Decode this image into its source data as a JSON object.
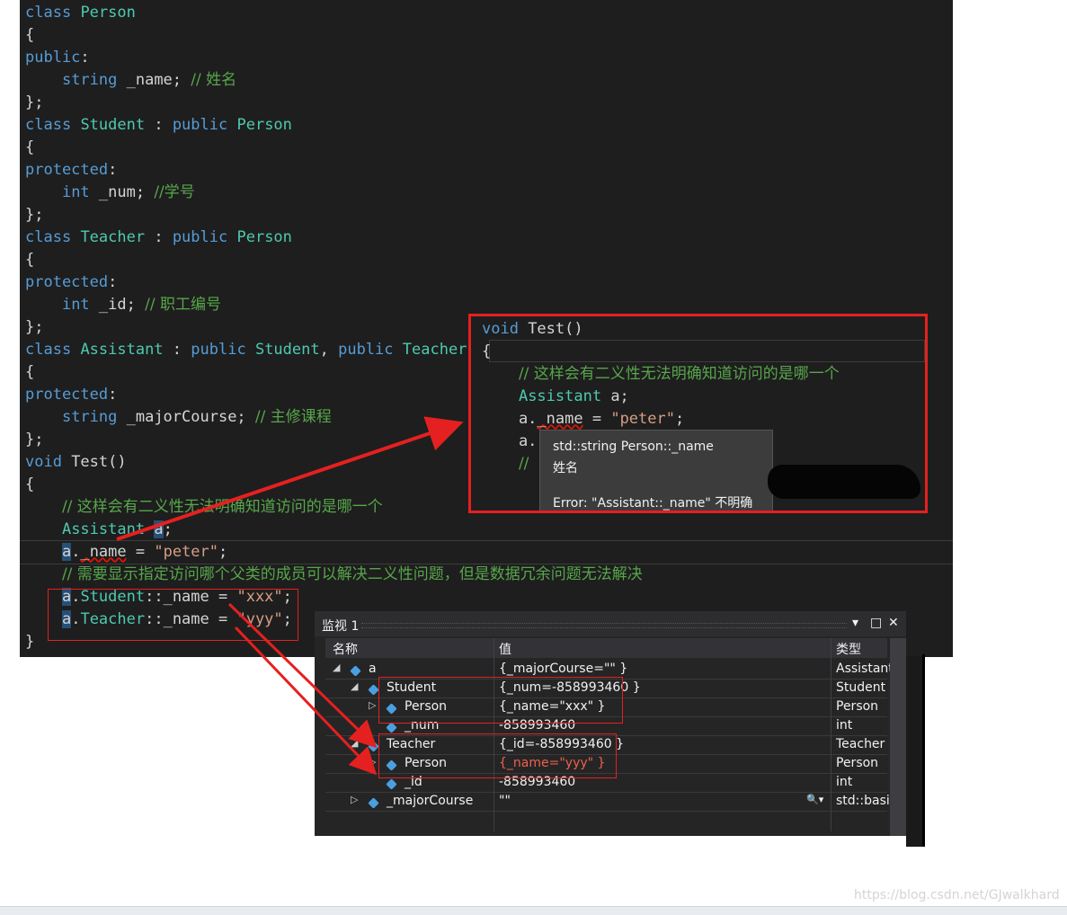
{
  "code_lines": [
    [
      {
        "c": "kw",
        "t": "class"
      },
      {
        "c": "pl",
        "t": " "
      },
      {
        "c": "ty",
        "t": "Person"
      }
    ],
    [
      {
        "c": "pl",
        "t": "{"
      }
    ],
    [
      {
        "c": "kw",
        "t": "public"
      },
      {
        "c": "pl",
        "t": ":"
      }
    ],
    [
      {
        "c": "pl",
        "t": "    "
      },
      {
        "c": "kw",
        "t": "string"
      },
      {
        "c": "pl",
        "t": " _name; "
      },
      {
        "c": "cm",
        "t": "// 姓名"
      }
    ],
    [
      {
        "c": "pl",
        "t": "};"
      }
    ],
    [
      {
        "c": "kw",
        "t": "class"
      },
      {
        "c": "pl",
        "t": " "
      },
      {
        "c": "ty",
        "t": "Student"
      },
      {
        "c": "pl",
        "t": " : "
      },
      {
        "c": "kw",
        "t": "public"
      },
      {
        "c": "pl",
        "t": " "
      },
      {
        "c": "ty",
        "t": "Person"
      }
    ],
    [
      {
        "c": "pl",
        "t": "{"
      }
    ],
    [
      {
        "c": "kw",
        "t": "protected"
      },
      {
        "c": "pl",
        "t": ":"
      }
    ],
    [
      {
        "c": "pl",
        "t": "    "
      },
      {
        "c": "kw",
        "t": "int"
      },
      {
        "c": "pl",
        "t": " _num; "
      },
      {
        "c": "cm",
        "t": "//学号"
      }
    ],
    [
      {
        "c": "pl",
        "t": "};"
      }
    ],
    [
      {
        "c": "kw",
        "t": "class"
      },
      {
        "c": "pl",
        "t": " "
      },
      {
        "c": "ty",
        "t": "Teacher"
      },
      {
        "c": "pl",
        "t": " : "
      },
      {
        "c": "kw",
        "t": "public"
      },
      {
        "c": "pl",
        "t": " "
      },
      {
        "c": "ty",
        "t": "Person"
      }
    ],
    [
      {
        "c": "pl",
        "t": "{"
      }
    ],
    [
      {
        "c": "kw",
        "t": "protected"
      },
      {
        "c": "pl",
        "t": ":"
      }
    ],
    [
      {
        "c": "pl",
        "t": "    "
      },
      {
        "c": "kw",
        "t": "int"
      },
      {
        "c": "pl",
        "t": " _id; "
      },
      {
        "c": "cm",
        "t": "// 职工编号"
      }
    ],
    [
      {
        "c": "pl",
        "t": "};"
      }
    ],
    [
      {
        "c": "kw",
        "t": "class"
      },
      {
        "c": "pl",
        "t": " "
      },
      {
        "c": "ty",
        "t": "Assistant"
      },
      {
        "c": "pl",
        "t": " : "
      },
      {
        "c": "kw",
        "t": "public"
      },
      {
        "c": "pl",
        "t": " "
      },
      {
        "c": "ty",
        "t": "Student"
      },
      {
        "c": "pl",
        "t": ", "
      },
      {
        "c": "kw",
        "t": "public"
      },
      {
        "c": "pl",
        "t": " "
      },
      {
        "c": "ty",
        "t": "Teacher"
      }
    ],
    [
      {
        "c": "pl",
        "t": "{"
      }
    ],
    [
      {
        "c": "kw",
        "t": "protected"
      },
      {
        "c": "pl",
        "t": ":"
      }
    ],
    [
      {
        "c": "pl",
        "t": "    "
      },
      {
        "c": "kw",
        "t": "string"
      },
      {
        "c": "pl",
        "t": " _majorCourse; "
      },
      {
        "c": "cm",
        "t": "// 主修课程"
      }
    ],
    [
      {
        "c": "pl",
        "t": "};"
      }
    ],
    [
      {
        "c": "kw",
        "t": "void"
      },
      {
        "c": "pl",
        "t": " Test()"
      }
    ],
    [
      {
        "c": "pl",
        "t": "{"
      }
    ],
    [
      {
        "c": "pl",
        "t": "    "
      },
      {
        "c": "cm",
        "t": "// 这样会有二义性无法明确知道访问的是哪一个"
      }
    ],
    [
      {
        "c": "pl",
        "t": "    "
      },
      {
        "c": "ty",
        "t": "Assistant"
      },
      {
        "c": "pl",
        "t": " "
      },
      {
        "c": "pl sel",
        "t": "a"
      },
      {
        "c": "pl",
        "t": ";"
      }
    ],
    [
      {
        "c": "pl",
        "t": "    "
      },
      {
        "c": "pl sel",
        "t": "a"
      },
      {
        "c": "pl",
        "t": "."
      },
      {
        "c": "pl squig",
        "t": "_name"
      },
      {
        "c": "pl",
        "t": " = "
      },
      {
        "c": "str",
        "t": "\"peter\""
      },
      {
        "c": "pl",
        "t": ";"
      }
    ],
    [
      {
        "c": "pl",
        "t": "    "
      },
      {
        "c": "cm",
        "t": "// 需要显示指定访问哪个父类的成员可以解决二义性问题，但是数据冗余问题无法解决"
      }
    ],
    [
      {
        "c": "pl",
        "t": "    "
      },
      {
        "c": "pl sel",
        "t": "a"
      },
      {
        "c": "pl",
        "t": "."
      },
      {
        "c": "ty",
        "t": "Student"
      },
      {
        "c": "pl",
        "t": "::_name = "
      },
      {
        "c": "str",
        "t": "\"xxx\""
      },
      {
        "c": "pl",
        "t": ";"
      }
    ],
    [
      {
        "c": "pl",
        "t": "    "
      },
      {
        "c": "pl sel",
        "t": "a"
      },
      {
        "c": "pl",
        "t": "."
      },
      {
        "c": "ty",
        "t": "Teacher"
      },
      {
        "c": "pl",
        "t": "::_name = "
      },
      {
        "c": "str",
        "t": "\"yyy\""
      },
      {
        "c": "pl",
        "t": ";"
      }
    ],
    [
      {
        "c": "pl",
        "t": "}"
      }
    ]
  ],
  "zoom_lines": [
    [
      {
        "c": "kw",
        "t": "void"
      },
      {
        "c": "pl",
        "t": " Test()"
      }
    ],
    [
      {
        "c": "pl",
        "t": "{"
      }
    ],
    [
      {
        "c": "pl",
        "t": "    "
      },
      {
        "c": "cm",
        "t": "// 这样会有二义性无法明确知道访问的是哪一个"
      }
    ],
    [
      {
        "c": "pl",
        "t": "    "
      },
      {
        "c": "ty",
        "t": "Assistant"
      },
      {
        "c": "pl",
        "t": " a;"
      }
    ],
    [
      {
        "c": "pl",
        "t": "    a."
      },
      {
        "c": "pl squig",
        "t": "_name"
      },
      {
        "c": "pl",
        "t": " = "
      },
      {
        "c": "str",
        "t": "\"peter\""
      },
      {
        "c": "pl",
        "t": ";"
      }
    ],
    [
      {
        "c": "pl",
        "t": "    a."
      }
    ],
    [
      {
        "c": "pl",
        "t": "    "
      },
      {
        "c": "cm",
        "t": "//"
      }
    ]
  ],
  "tooltip": {
    "signature": "std::string Person::_name",
    "comment": "姓名",
    "error": "Error: \"Assistant::_name\" 不明确"
  },
  "watch": {
    "title": "监视 1",
    "col_name": "名称",
    "col_value": "值",
    "col_type": "类型",
    "rows": [
      {
        "expander": "◢",
        "name": "a",
        "value": "{_majorCourse=\"\" }",
        "type": "Assistant",
        "indent": 0,
        "icon": "object-icon"
      },
      {
        "expander": "◢",
        "name": "Student",
        "value": "{_num=-858993460 }",
        "type": "Student",
        "indent": 1,
        "icon": "base-class-icon"
      },
      {
        "expander": "▷",
        "name": "Person",
        "value": "{_name=\"xxx\" }",
        "type": "Person",
        "indent": 2,
        "icon": "base-class-icon"
      },
      {
        "expander": "",
        "name": "_num",
        "value": "-858993460",
        "type": "int",
        "indent": 2,
        "icon": "protected-field-icon"
      },
      {
        "expander": "◢",
        "name": "Teacher",
        "value": "{_id=-858993460 }",
        "type": "Teacher",
        "indent": 1,
        "icon": "base-class-icon"
      },
      {
        "expander": "▷",
        "name": "Person",
        "value": "{_name=\"yyy\" }",
        "type": "Person",
        "indent": 2,
        "icon": "base-class-icon",
        "changed": true
      },
      {
        "expander": "",
        "name": "_id",
        "value": "-858993460",
        "type": "int",
        "indent": 2,
        "icon": "protected-field-icon"
      },
      {
        "expander": "▷",
        "name": "_majorCourse",
        "value": "\"\"",
        "type": "std::basic",
        "indent": 1,
        "icon": "protected-field-icon",
        "search": true
      }
    ]
  },
  "watermark": "https://blog.csdn.net/GJwalkhard",
  "colors": {
    "annotation_red": "#e52020",
    "editor_bg": "#1e1e1e",
    "keyword": "#569cd6",
    "type": "#4ec9b0",
    "comment": "#57a64a",
    "string": "#d69d85"
  }
}
